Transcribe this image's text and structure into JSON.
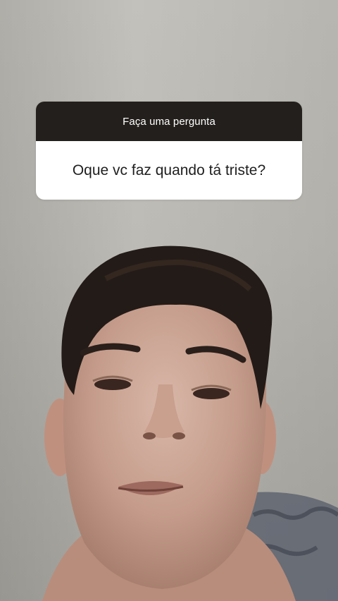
{
  "story": {
    "background_color": "#bdbbb5",
    "photo_subject_icon": "face-photo"
  },
  "question_sticker": {
    "header_label": "Faça uma pergunta",
    "question_text": "Oque vc faz quando tá triste?",
    "header_color": "#231f1c",
    "body_color": "#ffffff"
  }
}
